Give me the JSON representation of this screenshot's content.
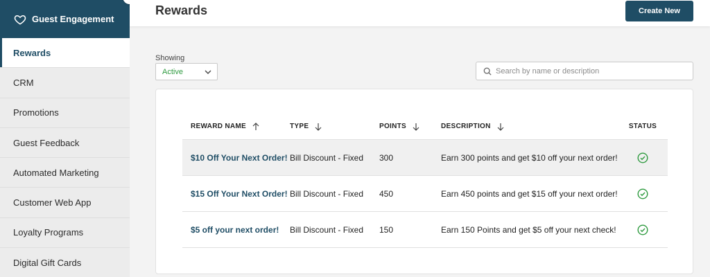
{
  "sidebar": {
    "brand": {
      "label": "Guest Engagement",
      "icon": "heart-icon"
    },
    "items": [
      {
        "label": "Rewards",
        "active": true
      },
      {
        "label": "CRM"
      },
      {
        "label": "Promotions"
      },
      {
        "label": "Guest Feedback"
      },
      {
        "label": "Automated Marketing"
      },
      {
        "label": "Customer Web App"
      },
      {
        "label": "Loyalty Programs"
      },
      {
        "label": "Digital Gift Cards"
      }
    ]
  },
  "header": {
    "title": "Rewards",
    "create_label": "Create New"
  },
  "filters": {
    "showing_label": "Showing",
    "selected": "Active",
    "search_placeholder": "Search by name or description"
  },
  "table": {
    "columns": [
      "REWARD NAME",
      "TYPE",
      "POINTS",
      "DESCRIPTION",
      "STATUS"
    ],
    "rows": [
      {
        "name": "$10 Off Your Next Order!",
        "type": "Bill Discount - Fixed",
        "points": "300",
        "description": "Earn 300 points and get $10 off your next order!",
        "status": "active"
      },
      {
        "name": "$15 Off Your Next Order!",
        "type": "Bill Discount - Fixed",
        "points": "450",
        "description": "Earn 450 points and get $15 off your next order!",
        "status": "active"
      },
      {
        "name": "$5 off your next order!",
        "type": "Bill Discount - Fixed",
        "points": "150",
        "description": "Earn 150 Points and get $5 off your next check!",
        "status": "active"
      }
    ]
  },
  "colors": {
    "brand": "#1f4d65",
    "success": "#2e9a3f"
  }
}
